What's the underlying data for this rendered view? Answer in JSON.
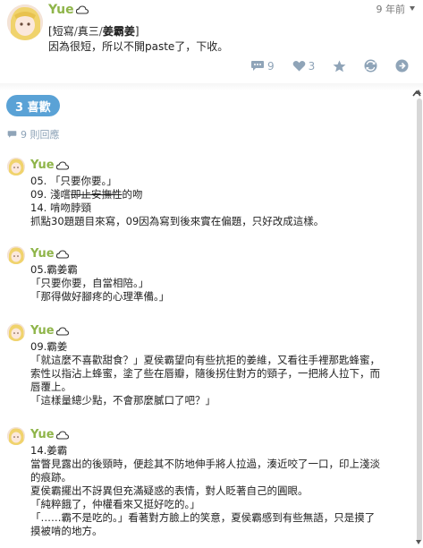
{
  "post": {
    "author": "Yue",
    "time": "9 年前",
    "tags": [
      "短寫",
      "真三",
      "姜霸姜"
    ],
    "tag_open": "[",
    "tag_close": "]",
    "tag_sep": "/",
    "body": "因為很短，所以不開paste了，下收。",
    "actions": {
      "comment_count": "9",
      "like_count": "3"
    }
  },
  "likes_label": "3 喜歡",
  "replies_label": "9 則回應",
  "replies": [
    {
      "author": "Yue",
      "lines": [
        "05. 「只要你要。」",
        "09. 淺嚐即止安撫性的吻",
        "14. 啃吻脖頸",
        "抓點30題題目來寫，09因為寫到後來實在偏題，只好改成這樣。"
      ],
      "line2_pre": "09. 淺嚐",
      "line2_strike": "即止安撫性",
      "line2_post": "的吻"
    },
    {
      "author": "Yue",
      "lines": [
        "05.霸姜霸",
        "「只要你要，自當相陪。」",
        "「那得做好腳疼的心理準備。」"
      ]
    },
    {
      "author": "Yue",
      "lines": [
        "09.霸姜",
        "「就這麼不喜歡甜食？」夏侯霸望向有些抗拒的姜維，又看往手裡那匙蜂蜜，",
        "索性以指沾上蜂蜜，塗了些在唇瓣，隨後拐住對方的頸子，一把將人拉下，而",
        "唇覆上。",
        "「這樣量總少點，不會那麼膩口了吧？」"
      ]
    },
    {
      "author": "Yue",
      "lines": [
        "14.姜霸",
        "當瞥見露出的後頸時，便趁其不防地伸手將人拉過，湊近咬了一口，印上淺淡",
        "的痕跡。",
        "夏侯霸擺出不訝異但充滿疑惑的表情，對人眨著自己的圓眼。",
        "「純粹餓了，仲權看來又挺好吃的。」",
        "「……霸不是吃的。」看著對方臉上的笑意，夏侯霸感到有些無語，只是摸了",
        "摸被啃的地方。"
      ]
    }
  ],
  "colors": {
    "author_green": "#8fb54a",
    "badge_blue": "#5aa2d6",
    "action_grey": "#8fa4b8"
  },
  "icons": [
    "cloud-icon",
    "comment-icon",
    "heart-icon",
    "share-icon",
    "reblog-icon",
    "menu-icon",
    "more-icon"
  ]
}
